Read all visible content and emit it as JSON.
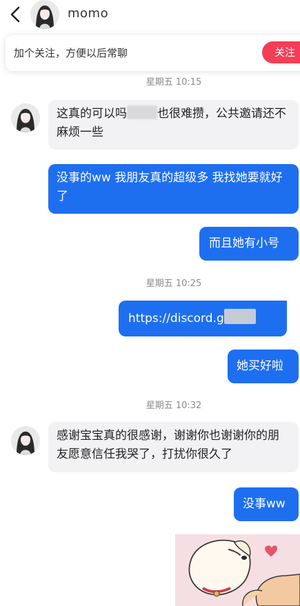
{
  "header": {
    "title": "momo"
  },
  "follow_prompt": {
    "text": "加个关注，方便以后常聊",
    "button_label": "关注"
  },
  "messages": [
    {
      "type": "time",
      "text": "星期五 10:15"
    },
    {
      "type": "in",
      "text_before": "这真的可以吗",
      "text_after": "也很难攒，公共邀请还不麻烦一些"
    },
    {
      "type": "out",
      "text": "没事的ww 我朋友真的超级多 我找她要就好了"
    },
    {
      "type": "out",
      "text": "而且她有小号"
    },
    {
      "type": "time",
      "text": "星期五 10:25"
    },
    {
      "type": "out",
      "text": "https://discord.g"
    },
    {
      "type": "out",
      "text": "她买好啦"
    },
    {
      "type": "time",
      "text": "星期五 10:32"
    },
    {
      "type": "in",
      "text": "感谢宝宝真的很感谢，谢谢你也谢谢你的朋友愿意信任我哭了，打扰你很久了"
    },
    {
      "type": "out",
      "text": "没事ww"
    },
    {
      "type": "out",
      "sticker": "dog-sticker"
    }
  ],
  "colors": {
    "accent_blue": "#1e6ff0",
    "follow_red": "#f33e55",
    "incoming_bubble": "#f2f2f4"
  }
}
